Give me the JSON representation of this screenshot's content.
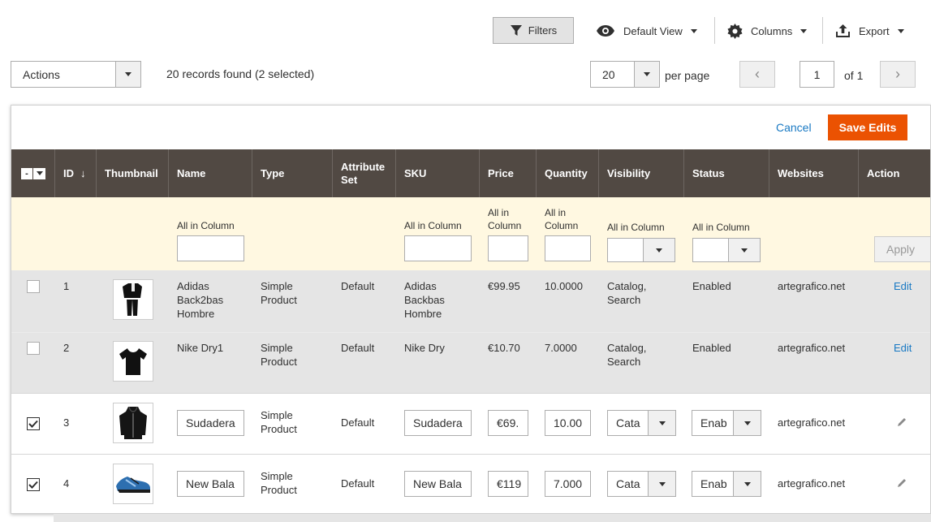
{
  "toolbar": {
    "filters_label": "Filters",
    "view_label": "Default View",
    "columns_label": "Columns",
    "export_label": "Export"
  },
  "actions": {
    "label": "Actions"
  },
  "records_text": "20 records found (2 selected)",
  "pager": {
    "per_page_value": "20",
    "per_page_label": "per page",
    "current_page": "1",
    "of_label": "of 1"
  },
  "edit_bar": {
    "cancel_label": "Cancel",
    "save_label": "Save Edits"
  },
  "columns": {
    "id": "ID",
    "thumbnail": "Thumbnail",
    "name": "Name",
    "type": "Type",
    "attribute_set_1": "Attribute",
    "attribute_set_2": "Set",
    "sku": "SKU",
    "price": "Price",
    "quantity": "Quantity",
    "visibility": "Visibility",
    "status": "Status",
    "websites": "Websites",
    "action": "Action"
  },
  "filter_row": {
    "all_in_column": "All in Column",
    "all_in": "All in",
    "column": "Column",
    "apply_label": "Apply"
  },
  "rows": [
    {
      "id": "1",
      "name_lines": [
        "Adidas",
        "Back2bas",
        "Hombre"
      ],
      "type_lines": [
        "Simple",
        "Product"
      ],
      "attribute_set": "Default",
      "sku_lines": [
        "Adidas",
        "Backbas",
        "Hombre"
      ],
      "price": "€99.95",
      "quantity": "10.0000",
      "visibility_lines": [
        "Catalog,",
        "Search"
      ],
      "status": "Enabled",
      "websites": "artegrafico.net",
      "action": "Edit"
    },
    {
      "id": "2",
      "name_lines": [
        "Nike Dry1"
      ],
      "type_lines": [
        "Simple",
        "Product"
      ],
      "attribute_set": "Default",
      "sku_lines": [
        "Nike Dry"
      ],
      "price": "€10.70",
      "quantity": "7.0000",
      "visibility_lines": [
        "Catalog,",
        "Search"
      ],
      "status": "Enabled",
      "websites": "artegrafico.net",
      "action": "Edit"
    },
    {
      "id": "3",
      "name_value": "Sudadera",
      "type_lines": [
        "Simple",
        "Product"
      ],
      "attribute_set": "Default",
      "sku_value": "Sudadera",
      "price_value": "€69.",
      "quantity_value": "10.00",
      "visibility_value": "Cata",
      "status_value": "Enab",
      "websites": "artegrafico.net"
    },
    {
      "id": "4",
      "name_value": "New Bala",
      "type_lines": [
        "Simple",
        "Product"
      ],
      "attribute_set": "Default",
      "sku_value": "New Bala",
      "price_value": "€119",
      "quantity_value": "7.000",
      "visibility_value": "Cata",
      "status_value": "Enab",
      "websites": "artegrafico.net"
    }
  ],
  "colors": {
    "header_bg": "#514943",
    "filter_bg": "#fff8e1",
    "save_button": "#eb5202",
    "link": "#1979c3"
  }
}
